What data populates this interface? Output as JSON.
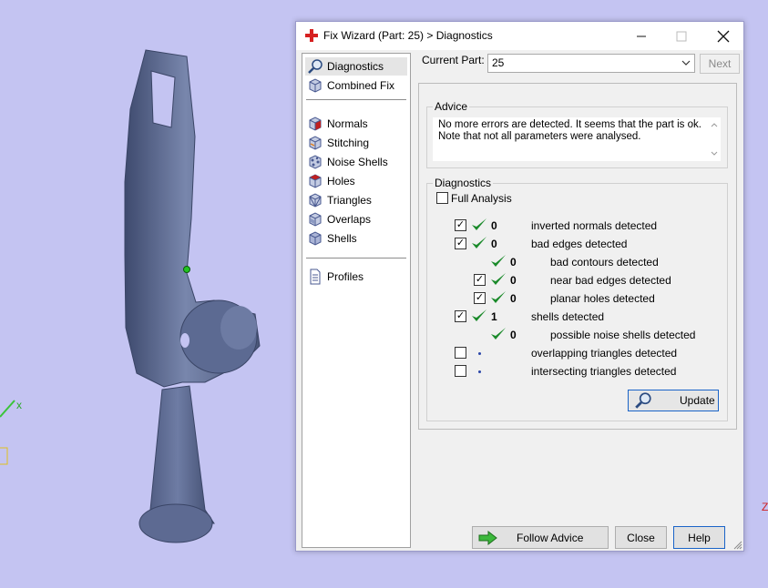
{
  "viewport": {
    "axis_x_label": "x",
    "axis_z_label": "Z"
  },
  "dialog": {
    "title": "Fix Wizard (Part: 25) > Diagnostics",
    "window_buttons": {
      "minimize": "—",
      "maximize": "☐",
      "close": "✕"
    },
    "nav": {
      "group1": [
        {
          "label": "Diagnostics",
          "icon": "magnifier-icon",
          "selected": true
        },
        {
          "label": "Combined Fix",
          "icon": "cube-icon"
        }
      ],
      "group2": [
        {
          "label": "Normals",
          "icon": "normals-cube-icon"
        },
        {
          "label": "Stitching",
          "icon": "stitching-cube-icon"
        },
        {
          "label": "Noise Shells",
          "icon": "noise-shells-icon"
        },
        {
          "label": "Holes",
          "icon": "holes-cube-icon"
        },
        {
          "label": "Triangles",
          "icon": "triangles-cube-icon"
        },
        {
          "label": "Overlaps",
          "icon": "overlaps-cube-icon"
        },
        {
          "label": "Shells",
          "icon": "shells-cube-icon"
        }
      ],
      "group3": [
        {
          "label": "Profiles",
          "icon": "document-icon"
        }
      ]
    },
    "current_part_label": "Current Part:",
    "current_part_value": "25",
    "next_label": "Next",
    "advice": {
      "legend": "Advice",
      "text": "No more errors are detected. It seems that the part is ok. Note that not all parameters were analysed."
    },
    "diagnostics": {
      "legend": "Diagnostics",
      "full_analysis_label": "Full Analysis",
      "full_analysis_checked": false,
      "rows": [
        {
          "checkbox": true,
          "checked": true,
          "status": "ok",
          "count": "0",
          "label": "inverted normals detected",
          "indent": 0
        },
        {
          "checkbox": true,
          "checked": true,
          "status": "ok",
          "count": "0",
          "label": "bad edges detected",
          "indent": 0
        },
        {
          "checkbox": false,
          "checked": false,
          "status": "ok",
          "count": "0",
          "label": "bad contours detected",
          "indent": 1
        },
        {
          "checkbox": true,
          "checked": true,
          "status": "ok",
          "count": "0",
          "label": "near bad edges detected",
          "indent": 1
        },
        {
          "checkbox": true,
          "checked": true,
          "status": "ok",
          "count": "0",
          "label": "planar holes detected",
          "indent": 1
        },
        {
          "checkbox": true,
          "checked": true,
          "status": "ok",
          "count": "1",
          "label": "shells detected",
          "indent": 0
        },
        {
          "checkbox": false,
          "checked": false,
          "status": "ok",
          "count": "0",
          "label": "possible noise shells detected",
          "indent": 1
        },
        {
          "checkbox": true,
          "checked": false,
          "status": "pending",
          "count": "",
          "label": "overlapping triangles detected",
          "indent": 0
        },
        {
          "checkbox": true,
          "checked": false,
          "status": "pending",
          "count": "",
          "label": "intersecting triangles detected",
          "indent": 0
        }
      ],
      "update_label": "Update"
    },
    "footer": {
      "follow_advice_label": "Follow Advice",
      "close_label": "Close",
      "help_label": "Help"
    },
    "colors": {
      "check_green": "#1a8a2a",
      "accent_blue": "#1a64c8",
      "title_icon_red": "#d62020"
    }
  }
}
